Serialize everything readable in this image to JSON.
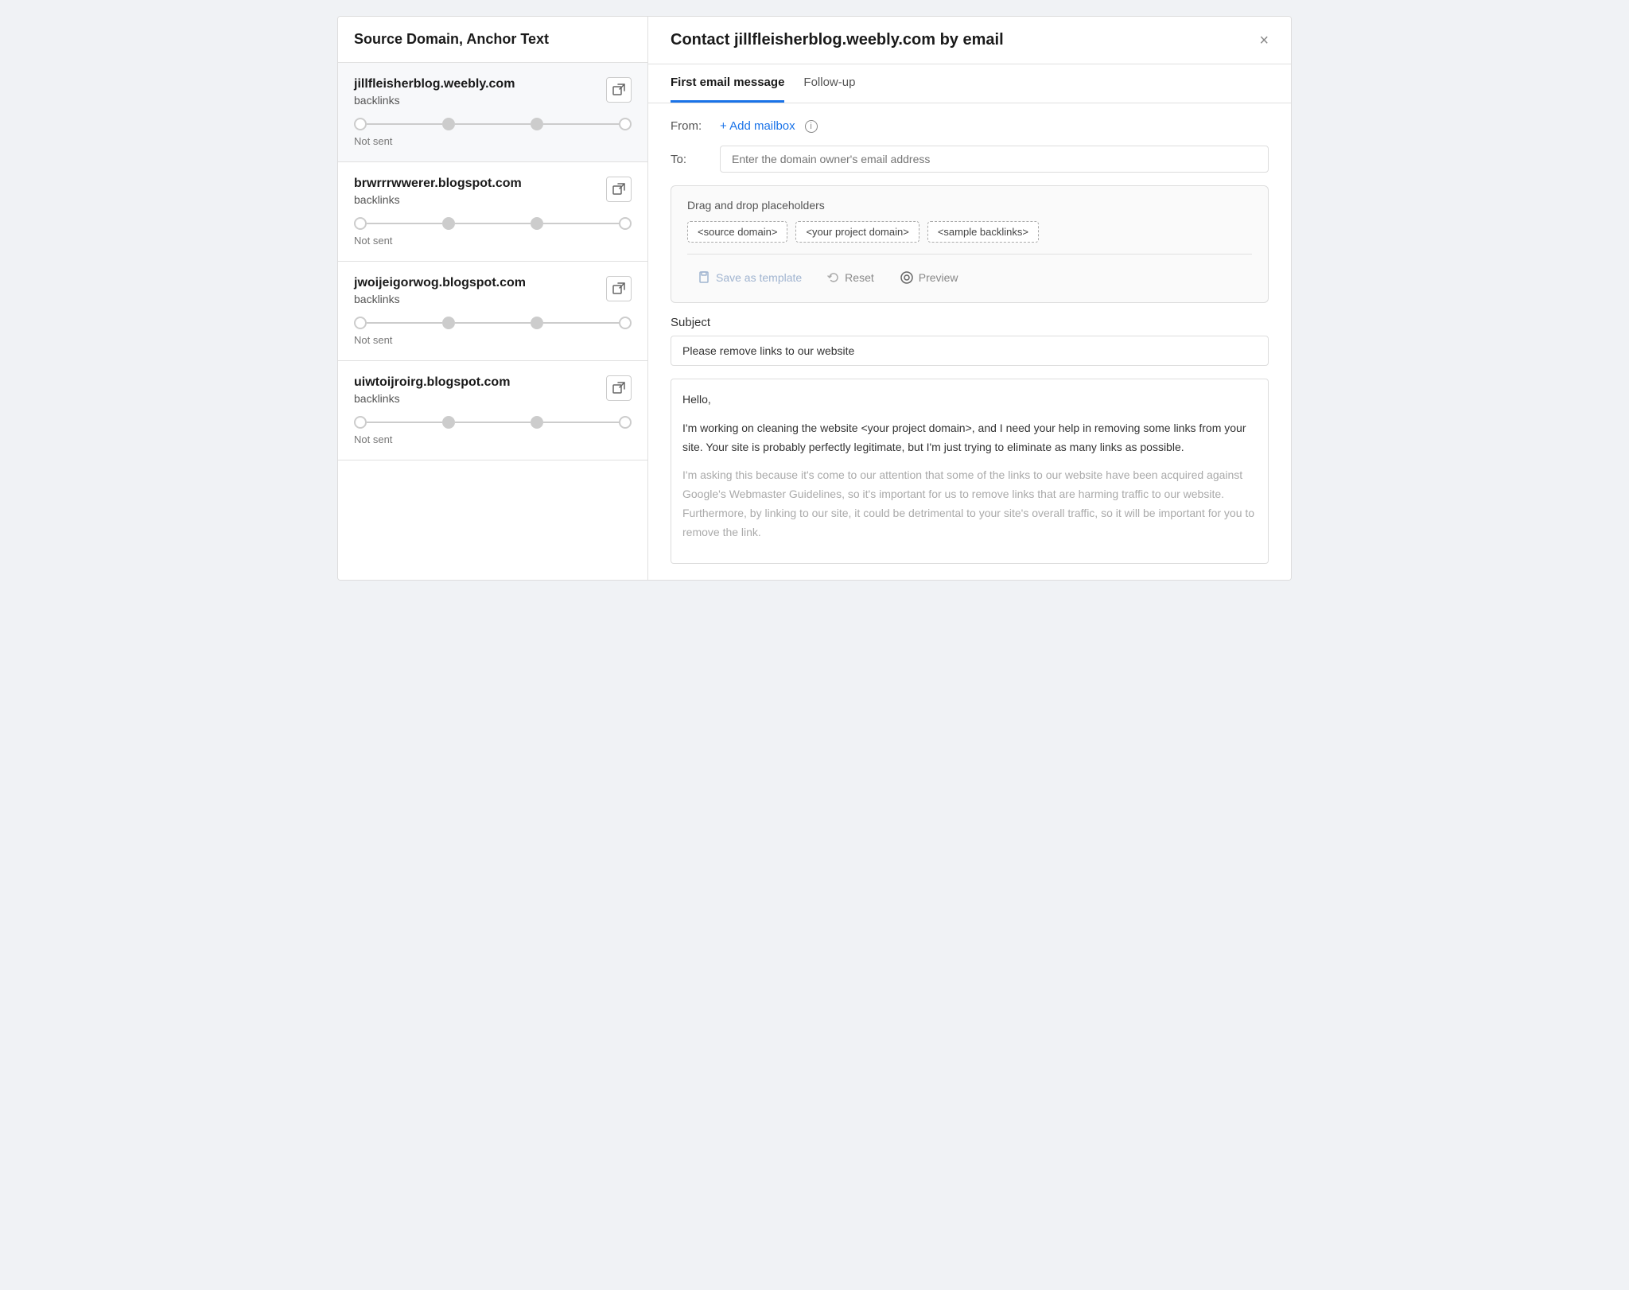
{
  "left_panel": {
    "header": "Source Domain, Anchor Text",
    "domains": [
      {
        "name": "jillfleisherblog.weebly.com",
        "type": "backlinks",
        "status": "Not sent",
        "is_active": true
      },
      {
        "name": "brwrrrwwerer.blogspot.com",
        "type": "backlinks",
        "status": "Not sent",
        "is_active": false
      },
      {
        "name": "jwoijeigorwog.blogspot.com",
        "type": "backlinks",
        "status": "Not sent",
        "is_active": false
      },
      {
        "name": "uiwtoijroirg.blogspot.com",
        "type": "backlinks",
        "status": "Not sent",
        "is_active": false
      }
    ]
  },
  "right_panel": {
    "title": "Contact jillfleisherblog.weebly.com by email",
    "close_label": "×",
    "tabs": [
      {
        "label": "First email message",
        "active": true
      },
      {
        "label": "Follow-up",
        "active": false
      }
    ],
    "from_label": "From:",
    "add_mailbox_label": "+ Add mailbox",
    "to_label": "To:",
    "to_placeholder": "Enter the domain owner's email address",
    "placeholder_section": {
      "label": "Drag and drop placeholders",
      "chips": [
        "<source domain>",
        "<your project domain>",
        "<sample backlinks>"
      ]
    },
    "actions": {
      "save_template": "Save as template",
      "reset": "Reset",
      "preview": "Preview"
    },
    "subject_label": "Subject",
    "subject_value": "Please remove links to our website",
    "email_body": "Hello,\n\nI'm working on cleaning the website <your project domain>, and I need your help in removing some links from your site. Your site is probably perfectly legitimate, but I'm just trying to eliminate as many links as possible.\n\nI'm asking this because it's come to our attention that some of the links to our website have been acquired against Google's Webmaster Guidelines, so it's important for us to remove links that are harming traffic to our website. Furthermore, by linking to our site, it could be detrimental to your site's overall traffic, so it will be important for you to remove the link."
  }
}
